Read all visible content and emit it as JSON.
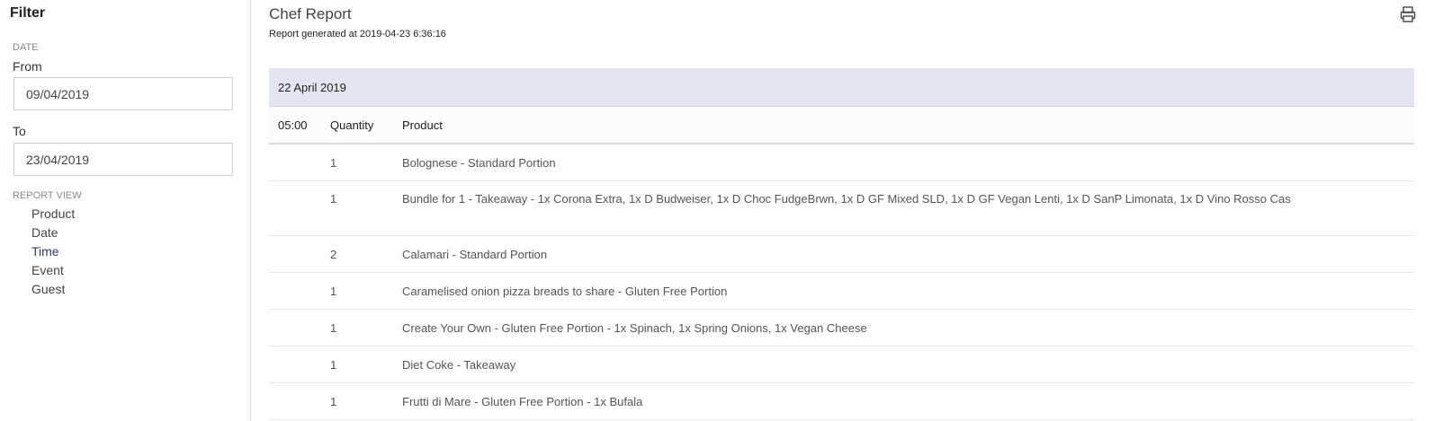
{
  "sidebar": {
    "title": "Filter",
    "date_section": "DATE",
    "from_label": "From",
    "from_value": "09/04/2019",
    "to_label": "To",
    "to_value": "23/04/2019",
    "report_view_section": "REPORT VIEW",
    "views": [
      {
        "label": "Product",
        "active": false
      },
      {
        "label": "Date",
        "active": false
      },
      {
        "label": "Time",
        "active": true
      },
      {
        "label": "Event",
        "active": false
      },
      {
        "label": "Guest",
        "active": false
      }
    ]
  },
  "report": {
    "title": "Chef Report",
    "generated": "Report generated at 2019-04-23 6:36:16",
    "print_icon": "printer-icon"
  },
  "table": {
    "group_date": "22 April 2019",
    "headers": {
      "time": "05:00",
      "quantity": "Quantity",
      "product": "Product"
    },
    "rows": [
      {
        "qty": "1",
        "product": "Bolognese - Standard Portion"
      },
      {
        "qty": "1",
        "product": "Bundle for 1 - Takeaway - 1x Corona Extra, 1x D Budweiser, 1x D Choc FudgeBrwn, 1x D GF Mixed SLD, 1x D GF Vegan Lenti, 1x D SanP Limonata, 1x D Vino Rosso Cas"
      },
      {
        "qty": "2",
        "product": "Calamari - Standard Portion"
      },
      {
        "qty": "1",
        "product": "Caramelised onion pizza breads to share - Gluten Free Portion"
      },
      {
        "qty": "1",
        "product": "Create Your Own - Gluten Free Portion - 1x Spinach, 1x Spring Onions, 1x Vegan Cheese"
      },
      {
        "qty": "1",
        "product": "Diet Coke - Takeaway"
      },
      {
        "qty": "1",
        "product": "Frutti di Mare - Gluten Free Portion - 1x Bufala"
      }
    ]
  },
  "colors": {
    "group_bg": "#e4e5f2",
    "active_view": "#2e3a6e"
  }
}
